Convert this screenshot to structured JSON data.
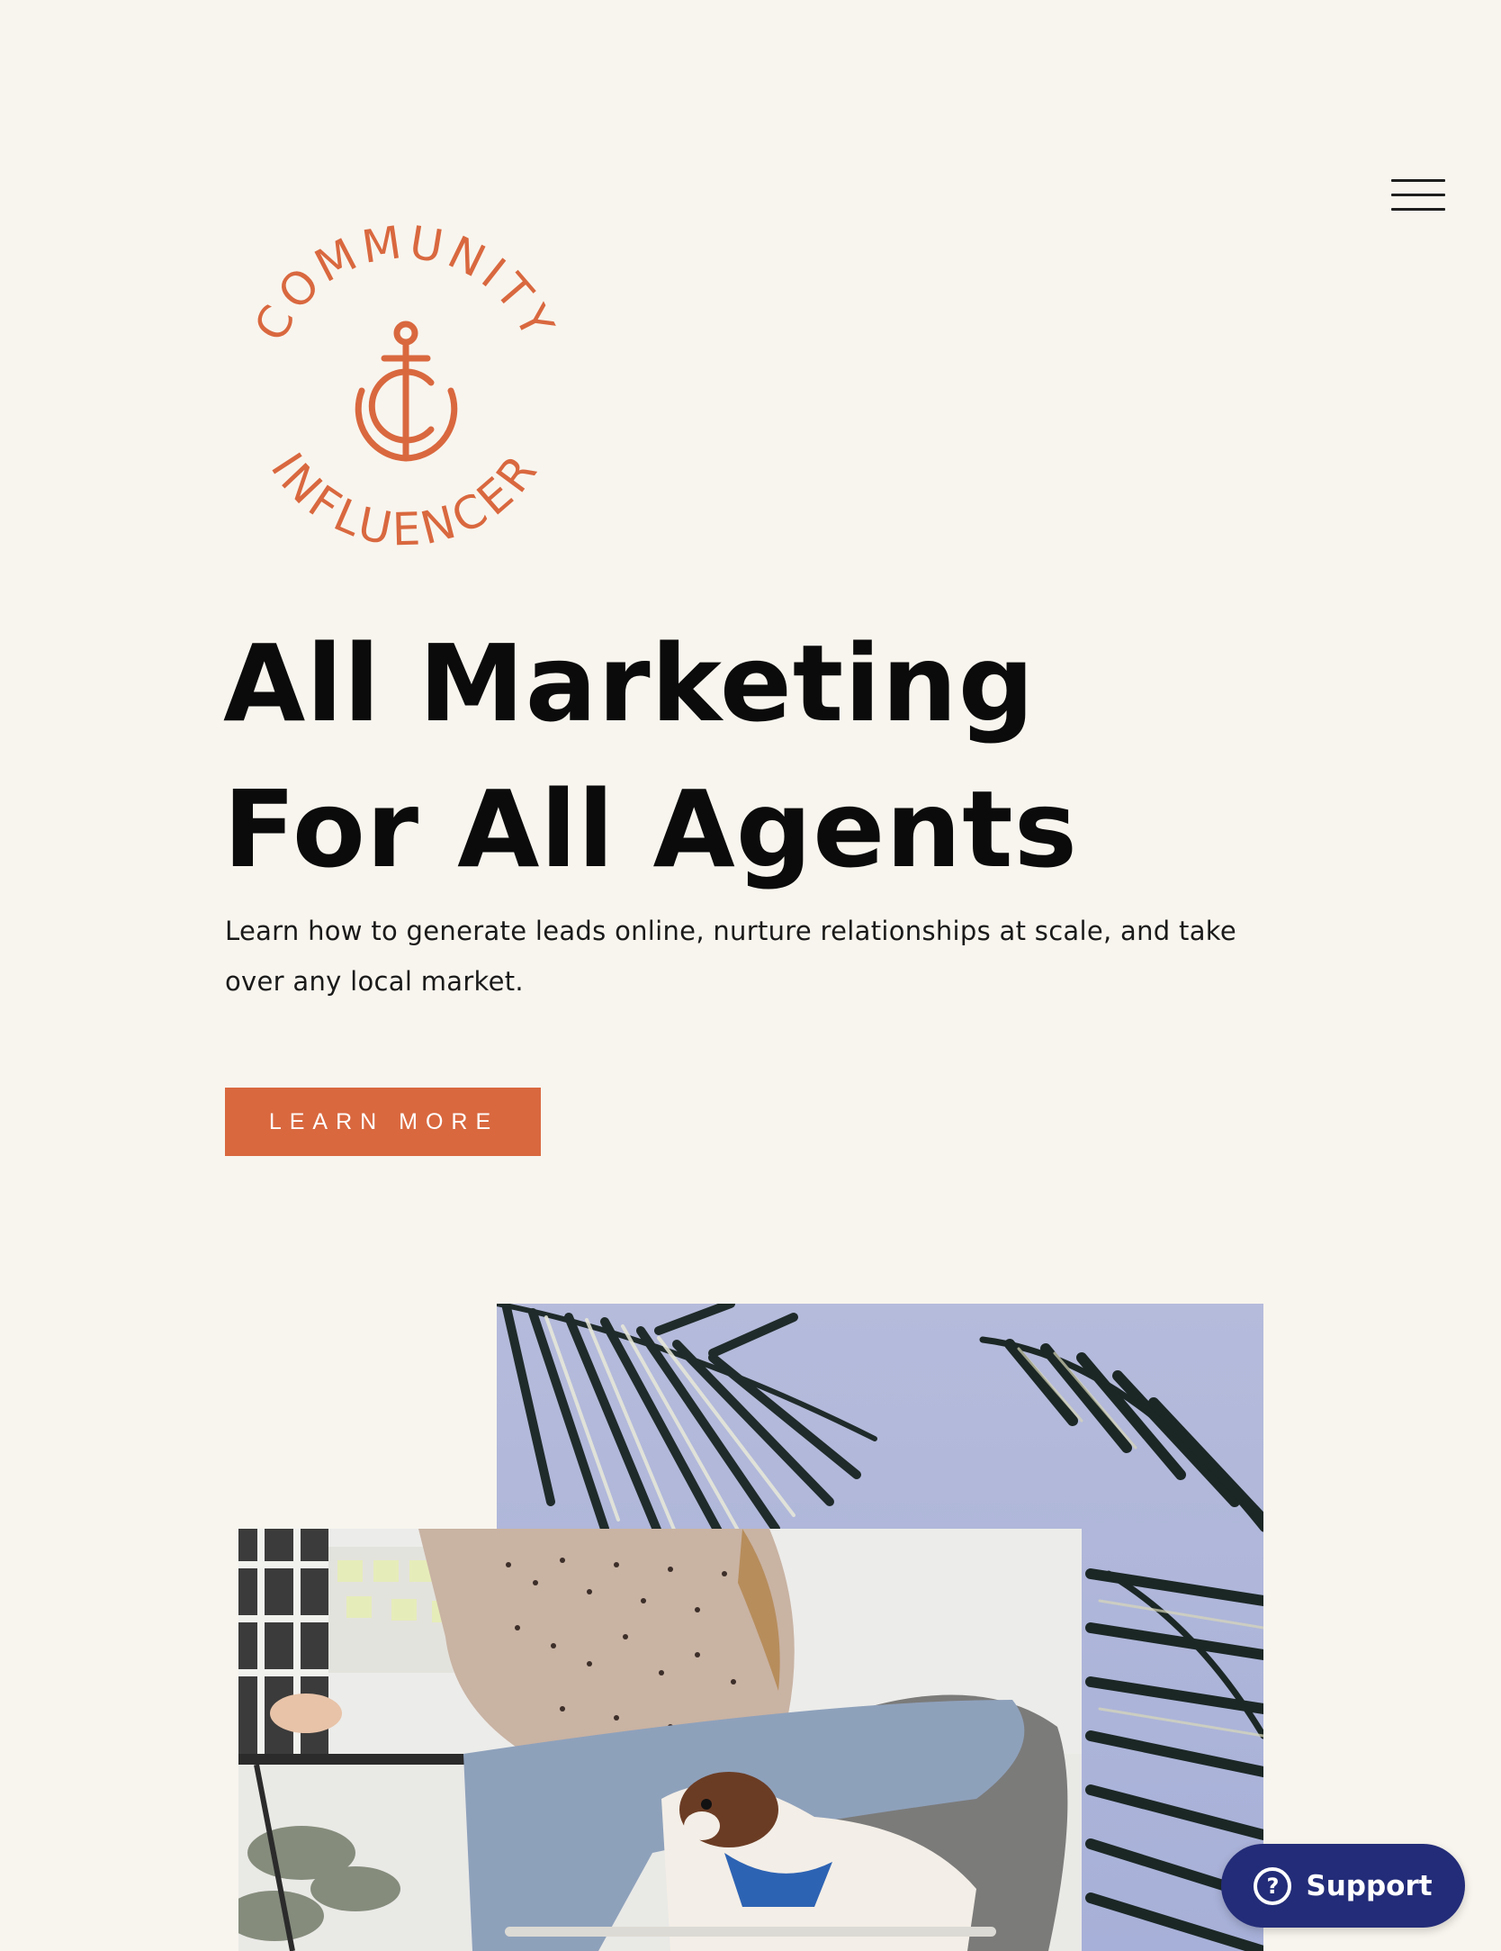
{
  "header": {
    "menu_icon": "hamburger-menu-icon"
  },
  "logo": {
    "text_top": "COMMUNITY",
    "text_bottom": "INFLUENCER",
    "icon": "anchor-icon",
    "color": "#d9683f"
  },
  "hero": {
    "headline_line1": "All Marketing",
    "headline_line2": "For All Agents",
    "subtext": "Learn how to generate leads online, nurture relationships at scale, and take over any local market.",
    "cta_label": "LEARN MORE"
  },
  "images": {
    "back": "palm-leaves-sky-photo",
    "front": "woman-writing-with-dog-photo"
  },
  "support": {
    "label": "Support",
    "icon": "question-circle-icon",
    "icon_glyph": "?"
  },
  "colors": {
    "background": "#f8f5ee",
    "accent": "#d9683f",
    "support_bg": "#232c78",
    "text": "#0b0b0b"
  }
}
